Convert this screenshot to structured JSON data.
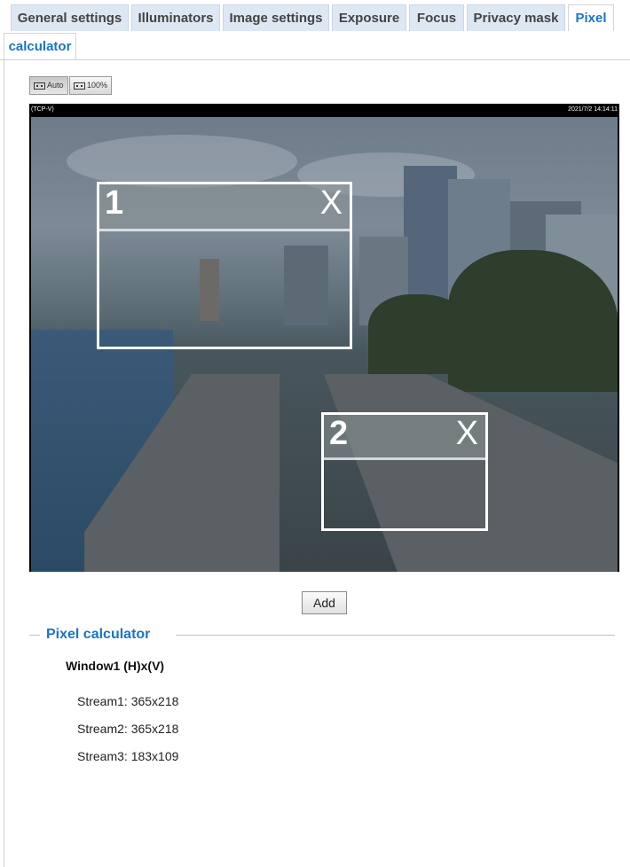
{
  "tabs": [
    {
      "label": "General settings",
      "active": false
    },
    {
      "label": "Illuminators",
      "active": false
    },
    {
      "label": "Image settings",
      "active": false
    },
    {
      "label": "Exposure",
      "active": false
    },
    {
      "label": "Focus",
      "active": false
    },
    {
      "label": "Privacy mask",
      "active": false
    },
    {
      "label": "Pixel",
      "active": true
    },
    {
      "label": "calculator",
      "active": true
    }
  ],
  "view_buttons": {
    "auto": "Auto",
    "full": "100%"
  },
  "video": {
    "label": "(TCP-V)",
    "timestamp": "2021/7/2 14:14:11",
    "masks": [
      {
        "number": "1",
        "close": "X"
      },
      {
        "number": "2",
        "close": "X"
      }
    ]
  },
  "add_button": "Add",
  "pixel_calculator": {
    "title": "Pixel calculator",
    "window_title": "Window1 (H)x(V)",
    "streams": [
      "Stream1: 365x218",
      "Stream2: 365x218",
      "Stream3: 183x109"
    ]
  },
  "colors": {
    "accent": "#1a74c9",
    "tab_bg": "#dde8f4",
    "mask_border": "#ffffff"
  }
}
